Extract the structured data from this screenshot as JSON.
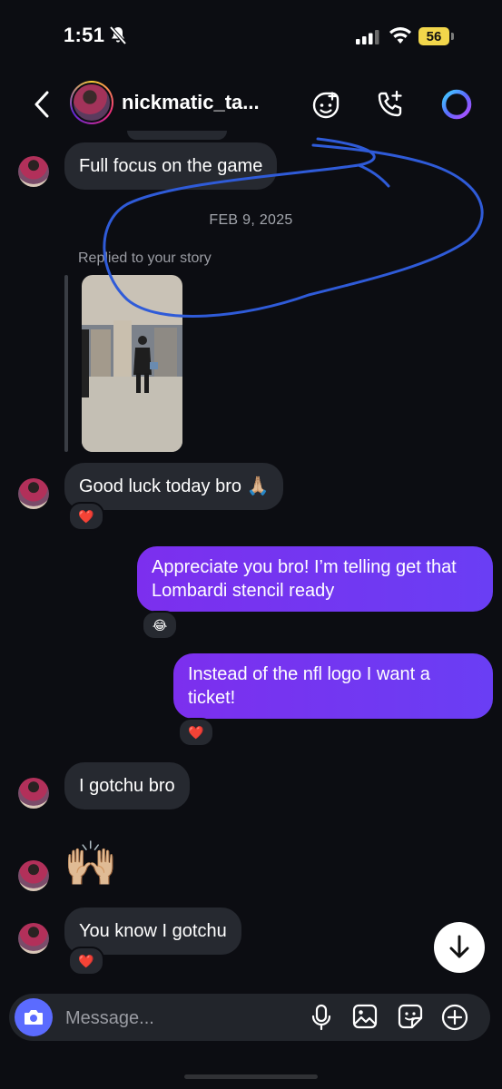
{
  "status_bar": {
    "time": "1:51",
    "battery": "56"
  },
  "header": {
    "username": "nickmatic_ta..."
  },
  "thread": {
    "msg1": "Full focus on the game",
    "date": "FEB 9, 2025",
    "reply_label": "Replied to your story",
    "msg2": "Good luck today bro 🙏🏼",
    "msg3": "Appreciate you bro! I’m telling get that Lombardi stencil ready",
    "msg4": "Instead of the nfl logo I want a ticket!",
    "msg5": "I gotchu bro",
    "msg6": "🙌🏼",
    "msg7": "You know I gotchu"
  },
  "reactions": {
    "r1": "❤️",
    "r2": "😂",
    "r3": "❤️",
    "r4": "❤️"
  },
  "composer": {
    "placeholder": "Message..."
  },
  "colors": {
    "outgoing_bubble": "#7a30ef",
    "incoming_bubble": "#262930",
    "annotation": "#2f5bd8"
  }
}
